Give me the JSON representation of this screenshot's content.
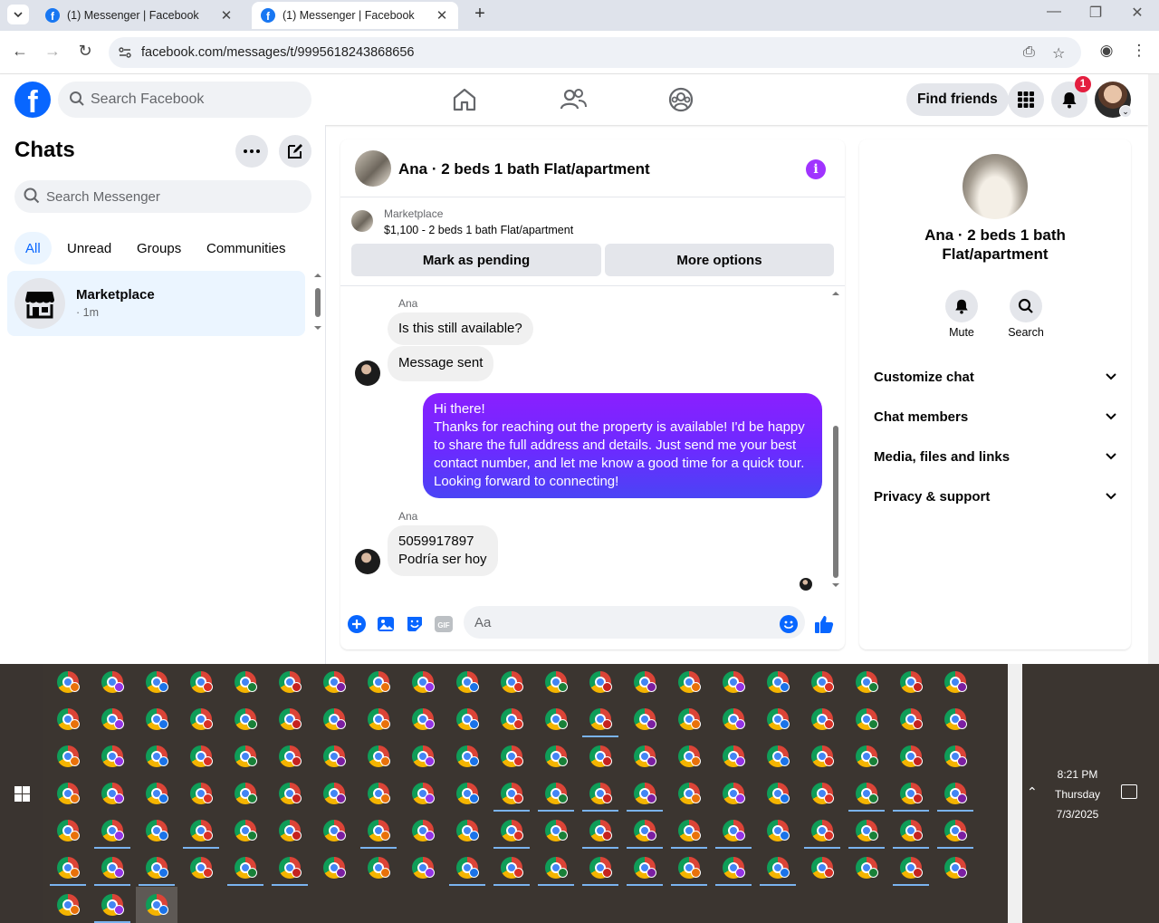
{
  "browser": {
    "tabs": [
      {
        "title": "(1) Messenger | Facebook",
        "active": false
      },
      {
        "title": "(1) Messenger | Facebook",
        "active": true
      }
    ],
    "url": "facebook.com/messages/t/9995618243868656"
  },
  "fb_header": {
    "search_placeholder": "Search Facebook",
    "find_friends": "Find friends",
    "notification_count": "1"
  },
  "left_panel": {
    "title": "Chats",
    "search_placeholder": "Search Messenger",
    "filters": [
      "All",
      "Unread",
      "Groups",
      "Communities"
    ],
    "active_filter": "All",
    "chats": [
      {
        "name": "Marketplace",
        "time": "· 1m"
      }
    ]
  },
  "conversation": {
    "title": "Ana · 2 beds 1 bath Flat/apartment",
    "marketplace_label": "Marketplace",
    "listing": "$1,100 - 2 beds 1 bath Flat/apartment",
    "buttons": [
      "Mark as pending",
      "More options"
    ],
    "messages": {
      "sender1": "Ana",
      "msg1": "Is this still available?",
      "msg2": "Message sent",
      "mine_lines": [
        "Hi there!",
        "Thanks for reaching out the property is available! I'd be happy",
        "to share the full address and details. Just send me your best",
        "contact number, and let me know a good time for a quick tour.",
        "Looking forward to connecting!"
      ],
      "sender2": "Ana",
      "msg3_line1": "5059917897",
      "msg3_line2": "Podría ser hoy"
    },
    "composer_placeholder": "Aa"
  },
  "right_panel": {
    "title": "Ana · 2 beds 1 bath Flat/apartment",
    "actions": [
      "Mute",
      "Search"
    ],
    "sections": [
      "Customize chat",
      "Chat members",
      "Media, files and links",
      "Privacy & support"
    ]
  },
  "taskbar": {
    "time": "8:21 PM",
    "day": "Thursday",
    "date": "7/3/2025"
  },
  "colors": {
    "fb_blue": "#0866ff",
    "bubble_gradient_top": "#8a1fff",
    "bubble_gradient_bottom": "#4a44f5",
    "badge_red": "#e41e3f"
  }
}
